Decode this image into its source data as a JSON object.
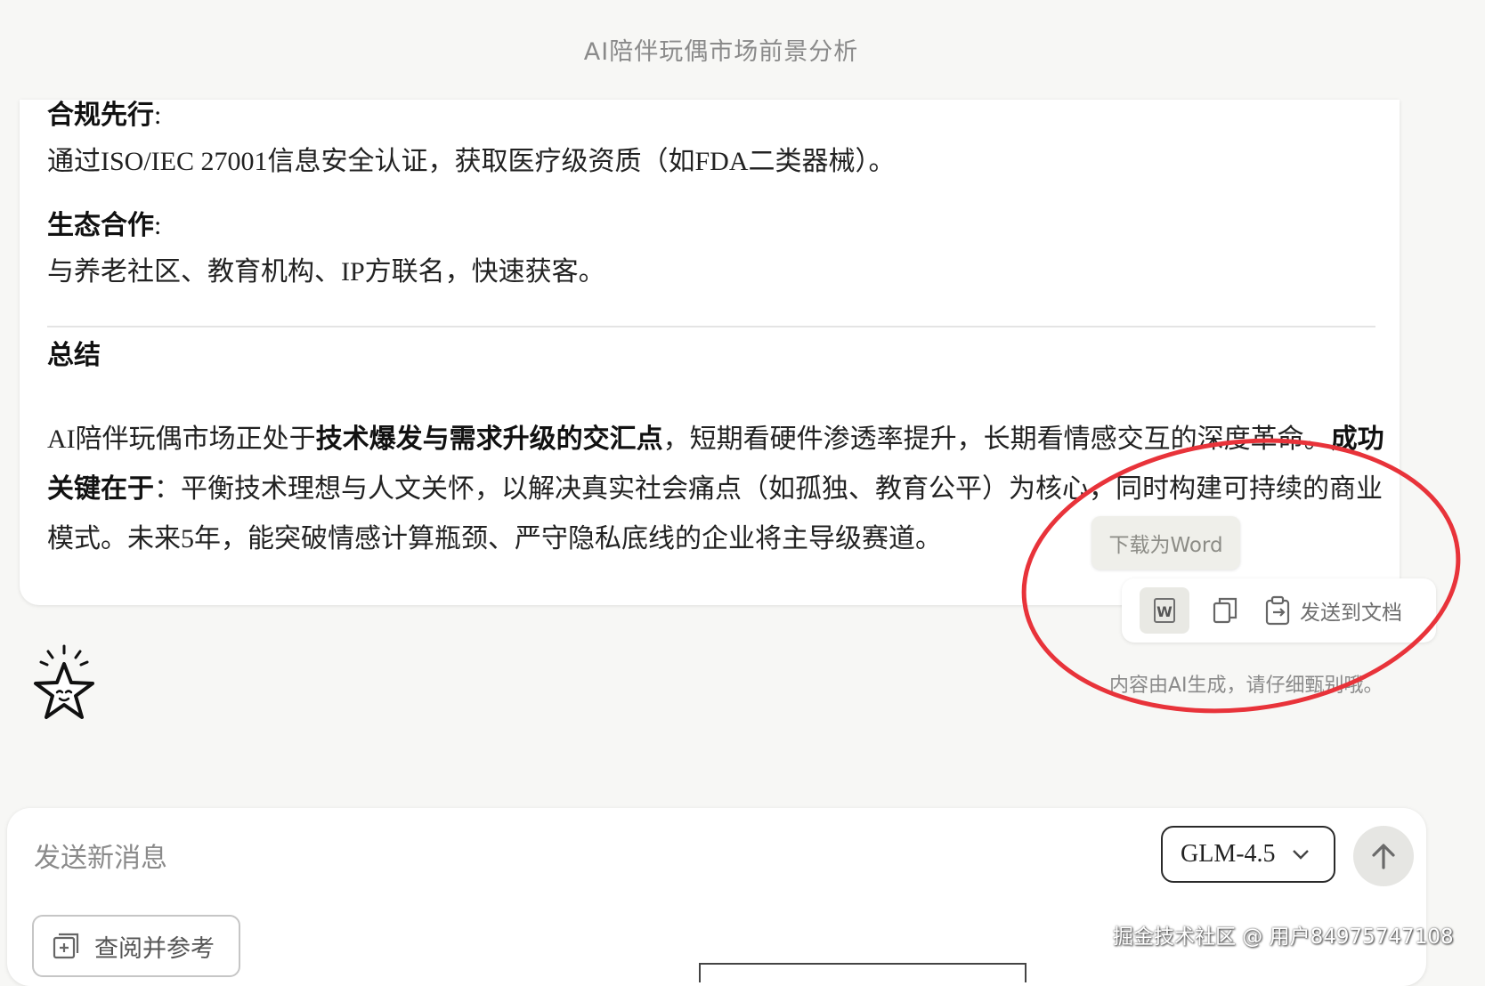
{
  "header": {
    "title": "AI陪伴玩偶市场前景分析"
  },
  "answer": {
    "compliance": {
      "heading": "合规先行",
      "colon": ":",
      "body": "通过ISO/IEC 27001信息安全认证，获取医疗级资质（如FDA二类器械）。"
    },
    "ecosystem": {
      "heading": "生态合作",
      "colon": ":",
      "body": "与养老社区、教育机构、IP方联名，快速获客。"
    },
    "summary": {
      "heading": "总结",
      "p1": "AI陪伴玩偶市场正处于",
      "b1": "技术爆发与需求升级的交汇点",
      "p2": "，短期看硬件渗透率提升，长期看情感交互的深度革命。",
      "b2": "成功关键在于",
      "p3": "：平衡技术理想与人文关怀，以解决真实社会痛点（如孤独、教育公平）为核心，同时构建可持续的商业模式。未来5年，能突破情感计算瓶颈、严守隐私底线的企业将主导",
      "p4": "级赛道。"
    }
  },
  "tooltip": {
    "text": "下载为Word"
  },
  "actions": {
    "word_icon_letter": "W",
    "send_to_doc": "发送到文档"
  },
  "disclaimer": "内容由AI生成，请仔细甄别哦。",
  "composer": {
    "placeholder": "发送新消息",
    "model": "GLM-4.5",
    "reference_label": "查阅并参考"
  },
  "watermark": "掘金技术社区 @ 用户84975747108",
  "colors": {
    "annotation_circle": "#e8333a",
    "accent_text": "#111111"
  }
}
